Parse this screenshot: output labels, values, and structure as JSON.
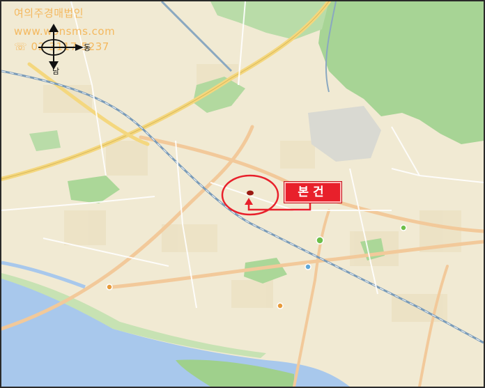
{
  "watermark": {
    "office": "여의주경매법인",
    "website": "www.wonsms.com",
    "phone": "☏ 02-3117-5237"
  },
  "compass": {
    "south": "남",
    "east": "동"
  },
  "target": {
    "label": "본건"
  },
  "colors": {
    "marker": "#e8202b",
    "river": "#a8c8ec",
    "park": "#9fd08c",
    "land": "#f1ead3",
    "watermark": "#f5b04a"
  }
}
